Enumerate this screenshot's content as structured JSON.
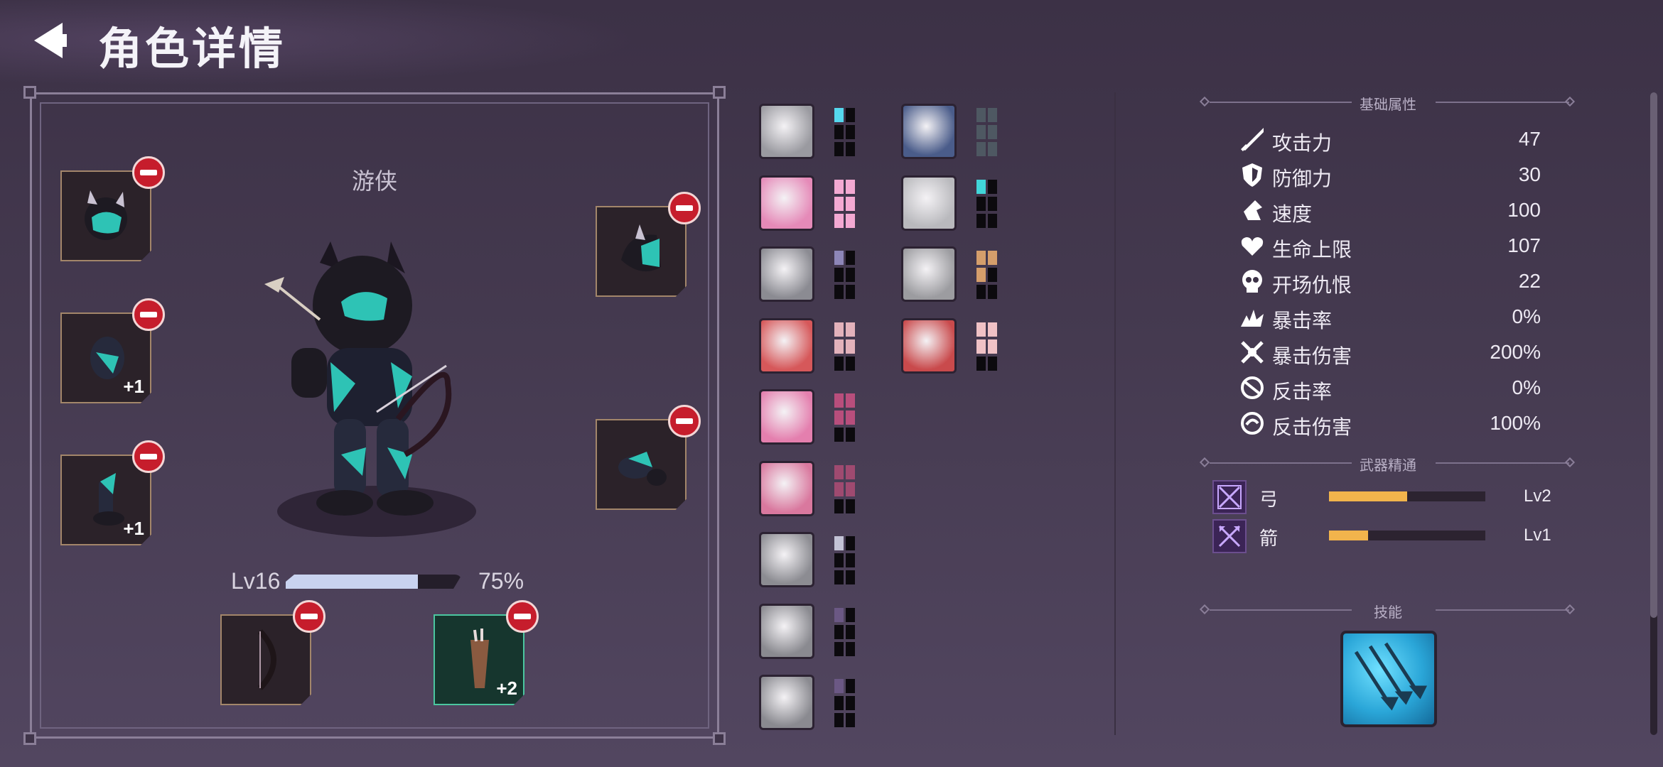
{
  "header": {
    "title": "角色详情",
    "back_icon": "back-arrow-icon"
  },
  "hero": {
    "class_name": "游侠",
    "level_label": "Lv16",
    "xp_percent_label": "75%",
    "xp_fraction": 0.75
  },
  "equipment": {
    "left_slots": [
      {
        "name": "helmet",
        "bonus": ""
      },
      {
        "name": "gauntlets",
        "bonus": "+1"
      },
      {
        "name": "boots",
        "bonus": "+1"
      }
    ],
    "right_slots": [
      {
        "name": "shoulder",
        "bonus": ""
      },
      {
        "name": "glove",
        "bonus": ""
      }
    ],
    "weapon_slots": [
      {
        "name": "bow",
        "bonus": ""
      },
      {
        "name": "quiver",
        "bonus": "+2"
      }
    ]
  },
  "skill_grid": {
    "col1": [
      {
        "icon": "fist-icon",
        "bg": "#9a9aa0",
        "pip_color": "#55d8ee",
        "filled": 1
      },
      {
        "icon": "boot-icon",
        "bg": "#e58ab8",
        "pip_color": "#f3a9d2",
        "filled": 6
      },
      {
        "icon": "warrior-icon",
        "bg": "#8b8b92",
        "pip_color": "#8d86b8",
        "filled": 1
      },
      {
        "icon": "spear-icon",
        "bg": "#d6585a",
        "pip_color": "#e3b2bb",
        "filled": 4
      },
      {
        "icon": "claw-icon",
        "bg": "#e47fae",
        "pip_color": "#b84e7c",
        "filled": 4
      },
      {
        "icon": "crossbow-icon",
        "bg": "#d9789e",
        "pip_color": "#9f4a70",
        "filled": 4
      },
      {
        "icon": "axe-icon",
        "bg": "#8c8c92",
        "pip_color": "#c3c3d6",
        "filled": 1
      },
      {
        "icon": "rage-icon",
        "bg": "#8a8a90",
        "pip_color": "#6b5884",
        "filled": 1
      },
      {
        "icon": "bag-icon",
        "bg": "#8a8a90",
        "pip_color": "#6b5884",
        "filled": 1
      }
    ],
    "col2": [
      {
        "icon": "potion-icon",
        "bg": "#4a5c8a",
        "pip_color": "#4e5862",
        "filled": 6
      },
      {
        "icon": "spirit-icon",
        "bg": "#b9b9bd",
        "pip_color": "#41d6d9",
        "filled": 1
      },
      {
        "icon": "orb-icon",
        "bg": "#9c9ca0",
        "pip_color": "#d59e6b",
        "filled": 3
      },
      {
        "icon": "swords-icon",
        "bg": "#c94a4c",
        "pip_color": "#f0c2c6",
        "filled": 4
      }
    ]
  },
  "attributes": {
    "header": "基础属性",
    "items": [
      {
        "icon": "sword-icon",
        "label": "攻击力",
        "value": "47"
      },
      {
        "icon": "shield-icon",
        "label": "防御力",
        "value": "30"
      },
      {
        "icon": "speed-icon",
        "label": "速度",
        "value": "100"
      },
      {
        "icon": "heart-icon",
        "label": "生命上限",
        "value": "107"
      },
      {
        "icon": "skull-icon",
        "label": "开场仇恨",
        "value": "22"
      },
      {
        "icon": "crit-icon",
        "label": "暴击率",
        "value": "0%"
      },
      {
        "icon": "crit-damage-icon",
        "label": "暴击伤害",
        "value": "200%"
      },
      {
        "icon": "counter-icon",
        "label": "反击率",
        "value": "0%"
      },
      {
        "icon": "counter-damage-icon",
        "label": "反击伤害",
        "value": "100%"
      }
    ]
  },
  "mastery": {
    "header": "武器精通",
    "items": [
      {
        "icon": "bow-mastery-icon",
        "label": "弓",
        "level": "Lv2",
        "fraction": 0.5
      },
      {
        "icon": "arrow-mastery-icon",
        "label": "箭",
        "level": "Lv1",
        "fraction": 0.25
      }
    ]
  },
  "skills": {
    "header": "技能",
    "items": [
      {
        "icon": "arrow-volley-icon"
      }
    ]
  },
  "colors": {
    "accent_remove": "#c61d2c",
    "xp_fill": "#c9d3f0",
    "mastery_fill": "#f2b44c",
    "skill_bg": "#2aa6d8"
  }
}
